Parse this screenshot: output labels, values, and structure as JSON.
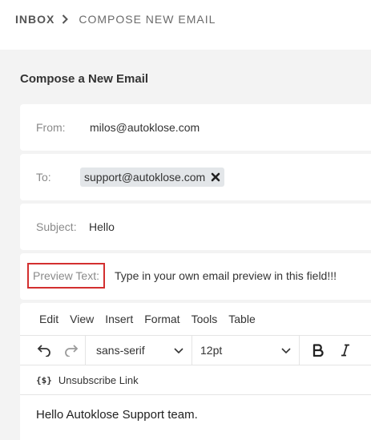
{
  "breadcrumb": {
    "inbox": "INBOX",
    "current": "COMPOSE NEW EMAIL"
  },
  "page": {
    "title": "Compose a New Email"
  },
  "fields": {
    "from_label": "From:",
    "from_value": "milos@autoklose.com",
    "to_label": "To:",
    "to_chip": "support@autoklose.com",
    "subject_label": "Subject:",
    "subject_value": "Hello",
    "preview_label": "Preview Text:",
    "preview_value": "Type in your own email preview in this field!!!"
  },
  "editor": {
    "menu": [
      "Edit",
      "View",
      "Insert",
      "Format",
      "Tools",
      "Table"
    ],
    "font_family": "sans-serif",
    "font_size": "12pt",
    "unsubscribe_icon": "{$}",
    "unsubscribe_label": "Unsubscribe Link",
    "body_text": "Hello Autoklose Support team."
  },
  "colors": {
    "highlight_border": "#d32f2f",
    "panel_bg": "#f3f3f3",
    "chip_bg": "#e3e6e9"
  },
  "icons": {
    "breadcrumb_separator": "chevron-right-icon",
    "chip_remove": "close-icon",
    "undo": "undo-icon",
    "redo": "redo-icon",
    "dropdown": "chevron-down-icon",
    "bold": "bold-icon",
    "italic": "italic-icon",
    "unsubscribe": "unsubscribe-tag-icon"
  }
}
